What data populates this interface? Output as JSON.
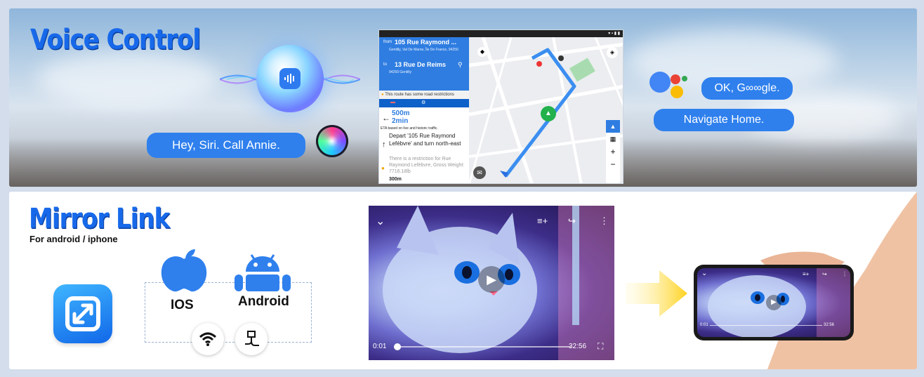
{
  "voice": {
    "title": "Voice Control",
    "siri_text": "Hey, Siri. Call Annie.",
    "google_ok": "OK, G∞∞gle.",
    "google_nav": "Navigate Home."
  },
  "map_app": {
    "from_label": "from",
    "from_name": "105 Rue Raymond ...",
    "from_addr": "Gentilly, Val De Marne, Île De France, 94250",
    "to_label": "to",
    "to_name": "13 Rue De Reims",
    "to_addr": "94250 Gentilly",
    "restriction": "This route has some road restrictions",
    "distance": "500m",
    "duration": "2min",
    "eta_note": "ETA based on live and historic traffic.",
    "instruction": "Depart '105 Rue Raymond Lefébvre' and turn north-east",
    "restriction_detail": "There is a restriction for Rue Raymond Lefébvre, Gross Weight: 7716.18lb",
    "next_distance": "300m"
  },
  "mirror": {
    "title": "Mirror Link",
    "subtitle": "For android / iphone",
    "ios_label": "IOS",
    "android_label": "Android"
  },
  "player": {
    "current_time": "0:01",
    "total_time": "32:56",
    "progress": 0.02
  },
  "phone_player": {
    "current_time": "0:01",
    "total_time": "32:56"
  },
  "colors": {
    "accent": "#2f80ed",
    "title_blue": "#1769ea"
  }
}
